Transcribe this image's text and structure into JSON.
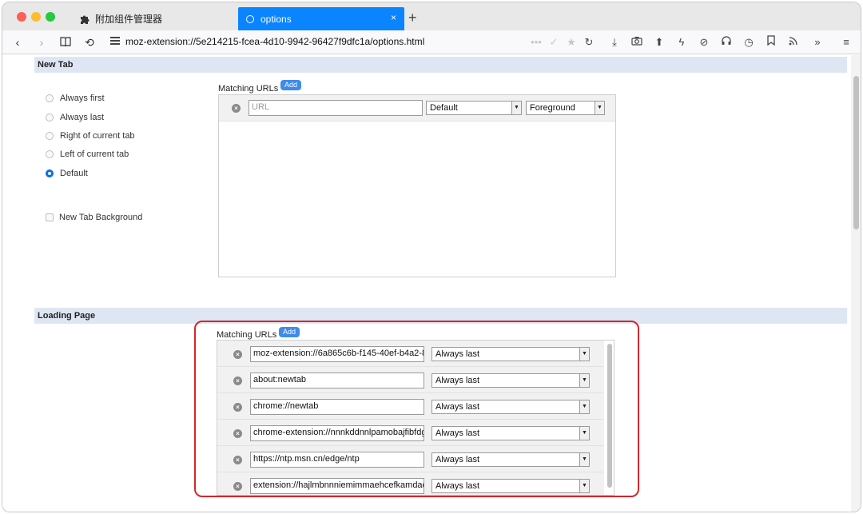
{
  "tabs": [
    {
      "label": "附加组件管理器",
      "icon": "puzzle-icon",
      "active": false
    },
    {
      "label": "options",
      "icon": "loading-ring-icon",
      "active": true,
      "close": "×"
    }
  ],
  "new_tab_button": "+",
  "address": {
    "url": "moz-extension://5e214215-fcea-4d10-9942-96427f9dfc1a/options.html"
  },
  "colors": {
    "accent": "#0a84ff",
    "section_header": "#dfe6f3",
    "highlight": "#d7252b",
    "add_button": "#3d8bea"
  },
  "new_tab_section": {
    "title": "New Tab",
    "options": [
      {
        "label": "Always first",
        "checked": false
      },
      {
        "label": "Always last",
        "checked": false
      },
      {
        "label": "Right of current tab",
        "checked": false
      },
      {
        "label": "Left of current tab",
        "checked": false
      },
      {
        "label": "Default",
        "checked": true
      }
    ],
    "background_checkbox": {
      "label": "New Tab Background",
      "checked": false
    },
    "matching_urls_label": "Matching URLs",
    "add_label": "Add",
    "rule": {
      "url_placeholder": "URL",
      "position": "Default",
      "mode": "Foreground"
    }
  },
  "loading_page_section": {
    "title": "Loading Page",
    "matching_urls_label": "Matching URLs",
    "add_label": "Add",
    "rules": [
      {
        "url": "moz-extension://6a865c6b-f145-40ef-b4a2-8",
        "position": "Always last"
      },
      {
        "url": "about:newtab",
        "position": "Always last"
      },
      {
        "url": "chrome://newtab",
        "position": "Always last"
      },
      {
        "url": "chrome-extension://nnnkddnnlpamobajfibfdg",
        "position": "Always last"
      },
      {
        "url": "https://ntp.msn.cn/edge/ntp",
        "position": "Always last"
      },
      {
        "url": "extension://hajlmbnnniemimmaehcefkamdad",
        "position": "Always last"
      }
    ]
  }
}
